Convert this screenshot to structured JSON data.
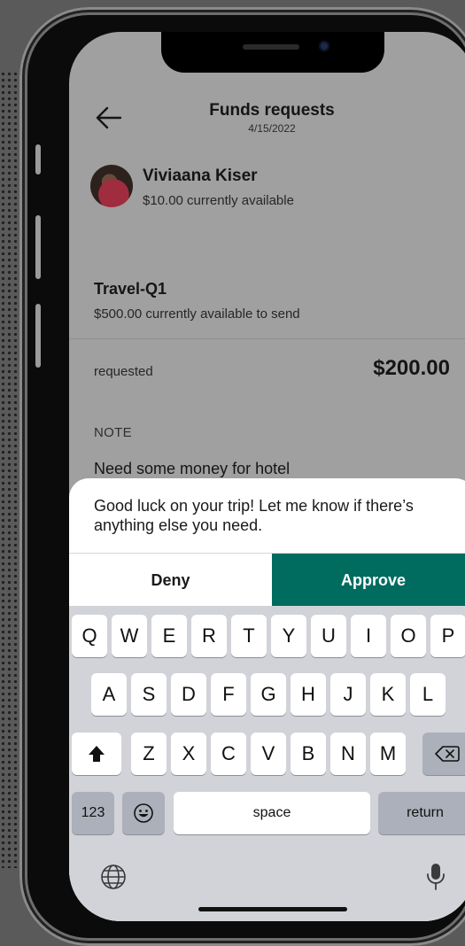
{
  "header": {
    "title": "Funds requests",
    "date": "4/15/2022"
  },
  "user": {
    "name": "Viviaana Kiser",
    "available": "$10.00 currently available"
  },
  "card": {
    "title": "Travel-Q1",
    "available": "$500.00 currently available to send"
  },
  "request": {
    "label": "requested",
    "amount": "$200.00"
  },
  "note": {
    "label": "NOTE",
    "text": "Need some money for hotel"
  },
  "reply": {
    "text": "Good luck on your trip! Let me know if there’s anything else you need."
  },
  "actions": {
    "deny": "Deny",
    "approve": "Approve"
  },
  "keyboard": {
    "row1": [
      "Q",
      "W",
      "E",
      "R",
      "T",
      "Y",
      "U",
      "I",
      "O",
      "P"
    ],
    "row2": [
      "A",
      "S",
      "D",
      "F",
      "G",
      "H",
      "J",
      "K",
      "L"
    ],
    "row3": [
      "Z",
      "X",
      "C",
      "V",
      "B",
      "N",
      "M"
    ],
    "numbers": "123",
    "space": "space",
    "return": "return"
  },
  "colors": {
    "approve": "#006b5f",
    "screen_overlay": "#a0a0a0"
  }
}
